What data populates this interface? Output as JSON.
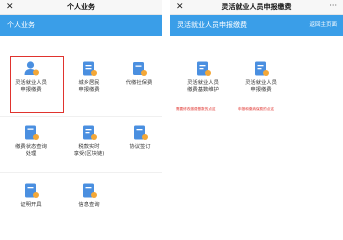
{
  "left": {
    "close": "✕",
    "title": "个人业务",
    "section": "个人业务",
    "tiles": [
      {
        "label": "灵活就业人员\n申报缴费"
      },
      {
        "label": "城乡居民\n申报缴费"
      },
      {
        "label": "代缴社保费"
      },
      {
        "label": "缴费状态查询\n处理"
      },
      {
        "label": "税款实时\n享受(区块链)"
      },
      {
        "label": "协议签订"
      },
      {
        "label": "证明开具"
      },
      {
        "label": "信息查询"
      }
    ]
  },
  "right": {
    "close": "✕",
    "title": "灵活就业人员申报缴费",
    "more": "···",
    "section": "灵活就业人员申报缴费",
    "return": "返回主页面",
    "tiles": [
      {
        "label": "灵活就业人员\n缴费基数维护",
        "note": "需要修改缴费基数的点这"
      },
      {
        "label": "灵活就业人员\n申报缴费",
        "note": "申报和缴纳保费的点这"
      }
    ]
  },
  "colors": {
    "blue": "#3a9ee8",
    "red": "#e0332e",
    "icon_blue": "#4a8fe0",
    "icon_orange": "#f4a838"
  }
}
